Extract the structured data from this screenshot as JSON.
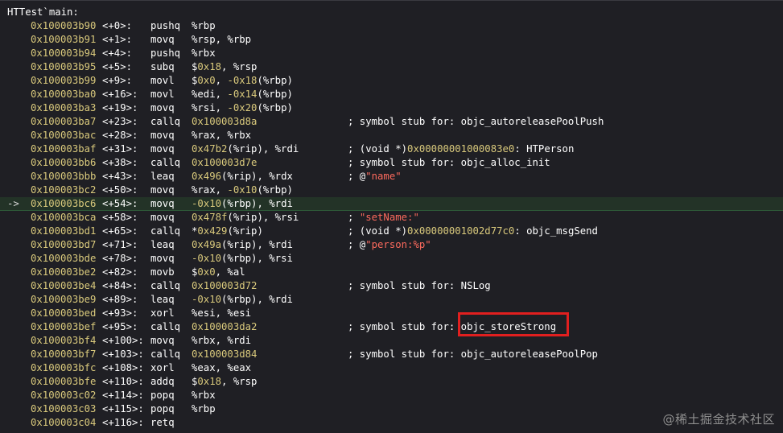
{
  "function_header": "HTTest`main:",
  "current_marker": "->",
  "rows": [
    {
      "addr": "0x100003b90",
      "off": "<+0>:",
      "mnem": "pushq",
      "ops": [
        {
          "t": "%rbp"
        }
      ],
      "comment": []
    },
    {
      "addr": "0x100003b91",
      "off": "<+1>:",
      "mnem": "movq",
      "ops": [
        {
          "t": "%rsp, %rbp"
        }
      ],
      "comment": []
    },
    {
      "addr": "0x100003b94",
      "off": "<+4>:",
      "mnem": "pushq",
      "ops": [
        {
          "t": "%rbx"
        }
      ],
      "comment": []
    },
    {
      "addr": "0x100003b95",
      "off": "<+5>:",
      "mnem": "subq",
      "ops": [
        {
          "t": "$"
        },
        {
          "t": "0x18",
          "c": "num"
        },
        {
          "t": ", %rsp"
        }
      ],
      "comment": []
    },
    {
      "addr": "0x100003b99",
      "off": "<+9>:",
      "mnem": "movl",
      "ops": [
        {
          "t": "$"
        },
        {
          "t": "0x0",
          "c": "num"
        },
        {
          "t": ", "
        },
        {
          "t": "-0x18",
          "c": "num"
        },
        {
          "t": "(%rbp)"
        }
      ],
      "comment": []
    },
    {
      "addr": "0x100003ba0",
      "off": "<+16>:",
      "mnem": "movl",
      "ops": [
        {
          "t": "%edi, "
        },
        {
          "t": "-0x14",
          "c": "num"
        },
        {
          "t": "(%rbp)"
        }
      ],
      "comment": []
    },
    {
      "addr": "0x100003ba3",
      "off": "<+19>:",
      "mnem": "movq",
      "ops": [
        {
          "t": "%rsi, "
        },
        {
          "t": "-0x20",
          "c": "num"
        },
        {
          "t": "(%rbp)"
        }
      ],
      "comment": []
    },
    {
      "addr": "0x100003ba7",
      "off": "<+23>:",
      "mnem": "callq",
      "ops": [
        {
          "t": "0x100003d8a",
          "c": "num"
        }
      ],
      "comment": [
        {
          "t": "; symbol stub for: objc_autoreleasePoolPush"
        }
      ]
    },
    {
      "addr": "0x100003bac",
      "off": "<+28>:",
      "mnem": "movq",
      "ops": [
        {
          "t": "%rax, %rbx"
        }
      ],
      "comment": []
    },
    {
      "addr": "0x100003baf",
      "off": "<+31>:",
      "mnem": "movq",
      "ops": [
        {
          "t": "0x47b2",
          "c": "num"
        },
        {
          "t": "(%rip), %rdi"
        }
      ],
      "comment": [
        {
          "t": "; (void *)"
        },
        {
          "t": "0x00000001000083e0",
          "c": "num"
        },
        {
          "t": ": HTPerson"
        }
      ]
    },
    {
      "addr": "0x100003bb6",
      "off": "<+38>:",
      "mnem": "callq",
      "ops": [
        {
          "t": "0x100003d7e",
          "c": "num"
        }
      ],
      "comment": [
        {
          "t": "; symbol stub for: objc_alloc_init"
        }
      ]
    },
    {
      "addr": "0x100003bbb",
      "off": "<+43>:",
      "mnem": "leaq",
      "ops": [
        {
          "t": "0x496",
          "c": "num"
        },
        {
          "t": "(%rip), %rdx"
        }
      ],
      "comment": [
        {
          "t": "; @"
        },
        {
          "t": "\"name\"",
          "c": "str"
        }
      ]
    },
    {
      "addr": "0x100003bc2",
      "off": "<+50>:",
      "mnem": "movq",
      "ops": [
        {
          "t": "%rax, "
        },
        {
          "t": "-0x10",
          "c": "num"
        },
        {
          "t": "(%rbp)"
        }
      ],
      "comment": []
    },
    {
      "addr": "0x100003bc6",
      "off": "<+54>:",
      "mnem": "movq",
      "ops": [
        {
          "t": "-0x10",
          "c": "num"
        },
        {
          "t": "(%rbp), %rdi"
        }
      ],
      "comment": [],
      "current": true
    },
    {
      "addr": "0x100003bca",
      "off": "<+58>:",
      "mnem": "movq",
      "ops": [
        {
          "t": "0x478f",
          "c": "num"
        },
        {
          "t": "(%rip), %rsi"
        }
      ],
      "comment": [
        {
          "t": "; "
        },
        {
          "t": "\"setName:\"",
          "c": "str"
        }
      ]
    },
    {
      "addr": "0x100003bd1",
      "off": "<+65>:",
      "mnem": "callq",
      "ops": [
        {
          "t": "*"
        },
        {
          "t": "0x429",
          "c": "num"
        },
        {
          "t": "(%rip)"
        }
      ],
      "comment": [
        {
          "t": "; (void *)"
        },
        {
          "t": "0x00000001002d77c0",
          "c": "num"
        },
        {
          "t": ": objc_msgSend"
        }
      ]
    },
    {
      "addr": "0x100003bd7",
      "off": "<+71>:",
      "mnem": "leaq",
      "ops": [
        {
          "t": "0x49a",
          "c": "num"
        },
        {
          "t": "(%rip), %rdi"
        }
      ],
      "comment": [
        {
          "t": "; @"
        },
        {
          "t": "\"person:%p\"",
          "c": "str"
        }
      ]
    },
    {
      "addr": "0x100003bde",
      "off": "<+78>:",
      "mnem": "movq",
      "ops": [
        {
          "t": "-0x10",
          "c": "num"
        },
        {
          "t": "(%rbp), %rsi"
        }
      ],
      "comment": []
    },
    {
      "addr": "0x100003be2",
      "off": "<+82>:",
      "mnem": "movb",
      "ops": [
        {
          "t": "$"
        },
        {
          "t": "0x0",
          "c": "num"
        },
        {
          "t": ", %al"
        }
      ],
      "comment": []
    },
    {
      "addr": "0x100003be4",
      "off": "<+84>:",
      "mnem": "callq",
      "ops": [
        {
          "t": "0x100003d72",
          "c": "num"
        }
      ],
      "comment": [
        {
          "t": "; symbol stub for: NSLog"
        }
      ]
    },
    {
      "addr": "0x100003be9",
      "off": "<+89>:",
      "mnem": "leaq",
      "ops": [
        {
          "t": "-0x10",
          "c": "num"
        },
        {
          "t": "(%rbp), %rdi"
        }
      ],
      "comment": []
    },
    {
      "addr": "0x100003bed",
      "off": "<+93>:",
      "mnem": "xorl",
      "ops": [
        {
          "t": "%esi, %esi"
        }
      ],
      "comment": []
    },
    {
      "addr": "0x100003bef",
      "off": "<+95>:",
      "mnem": "callq",
      "ops": [
        {
          "t": "0x100003da2",
          "c": "num"
        }
      ],
      "comment": [
        {
          "t": "; symbol stub for: objc_storeStrong"
        }
      ],
      "highlighted": true
    },
    {
      "addr": "0x100003bf4",
      "off": "<+100>:",
      "mnem": "movq",
      "ops": [
        {
          "t": "%rbx, %rdi"
        }
      ],
      "comment": []
    },
    {
      "addr": "0x100003bf7",
      "off": "<+103>:",
      "mnem": "callq",
      "ops": [
        {
          "t": "0x100003d84",
          "c": "num"
        }
      ],
      "comment": [
        {
          "t": "; symbol stub for: objc_autoreleasePoolPop"
        }
      ]
    },
    {
      "addr": "0x100003bfc",
      "off": "<+108>:",
      "mnem": "xorl",
      "ops": [
        {
          "t": "%eax, %eax"
        }
      ],
      "comment": []
    },
    {
      "addr": "0x100003bfe",
      "off": "<+110>:",
      "mnem": "addq",
      "ops": [
        {
          "t": "$"
        },
        {
          "t": "0x18",
          "c": "num"
        },
        {
          "t": ", %rsp"
        }
      ],
      "comment": []
    },
    {
      "addr": "0x100003c02",
      "off": "<+114>:",
      "mnem": "popq",
      "ops": [
        {
          "t": "%rbx"
        }
      ],
      "comment": []
    },
    {
      "addr": "0x100003c03",
      "off": "<+115>:",
      "mnem": "popq",
      "ops": [
        {
          "t": "%rbp"
        }
      ],
      "comment": []
    },
    {
      "addr": "0x100003c04",
      "off": "<+116>:",
      "mnem": "retq",
      "ops": [],
      "comment": []
    }
  ],
  "watermark": "@稀土掘金技术社区",
  "colors": {
    "background": "#1f1f24",
    "text": "#ffffff",
    "number": "#d9c97c",
    "string": "#fc6a5d",
    "current_line": "#233327",
    "highlight_box": "#e11f1f"
  }
}
